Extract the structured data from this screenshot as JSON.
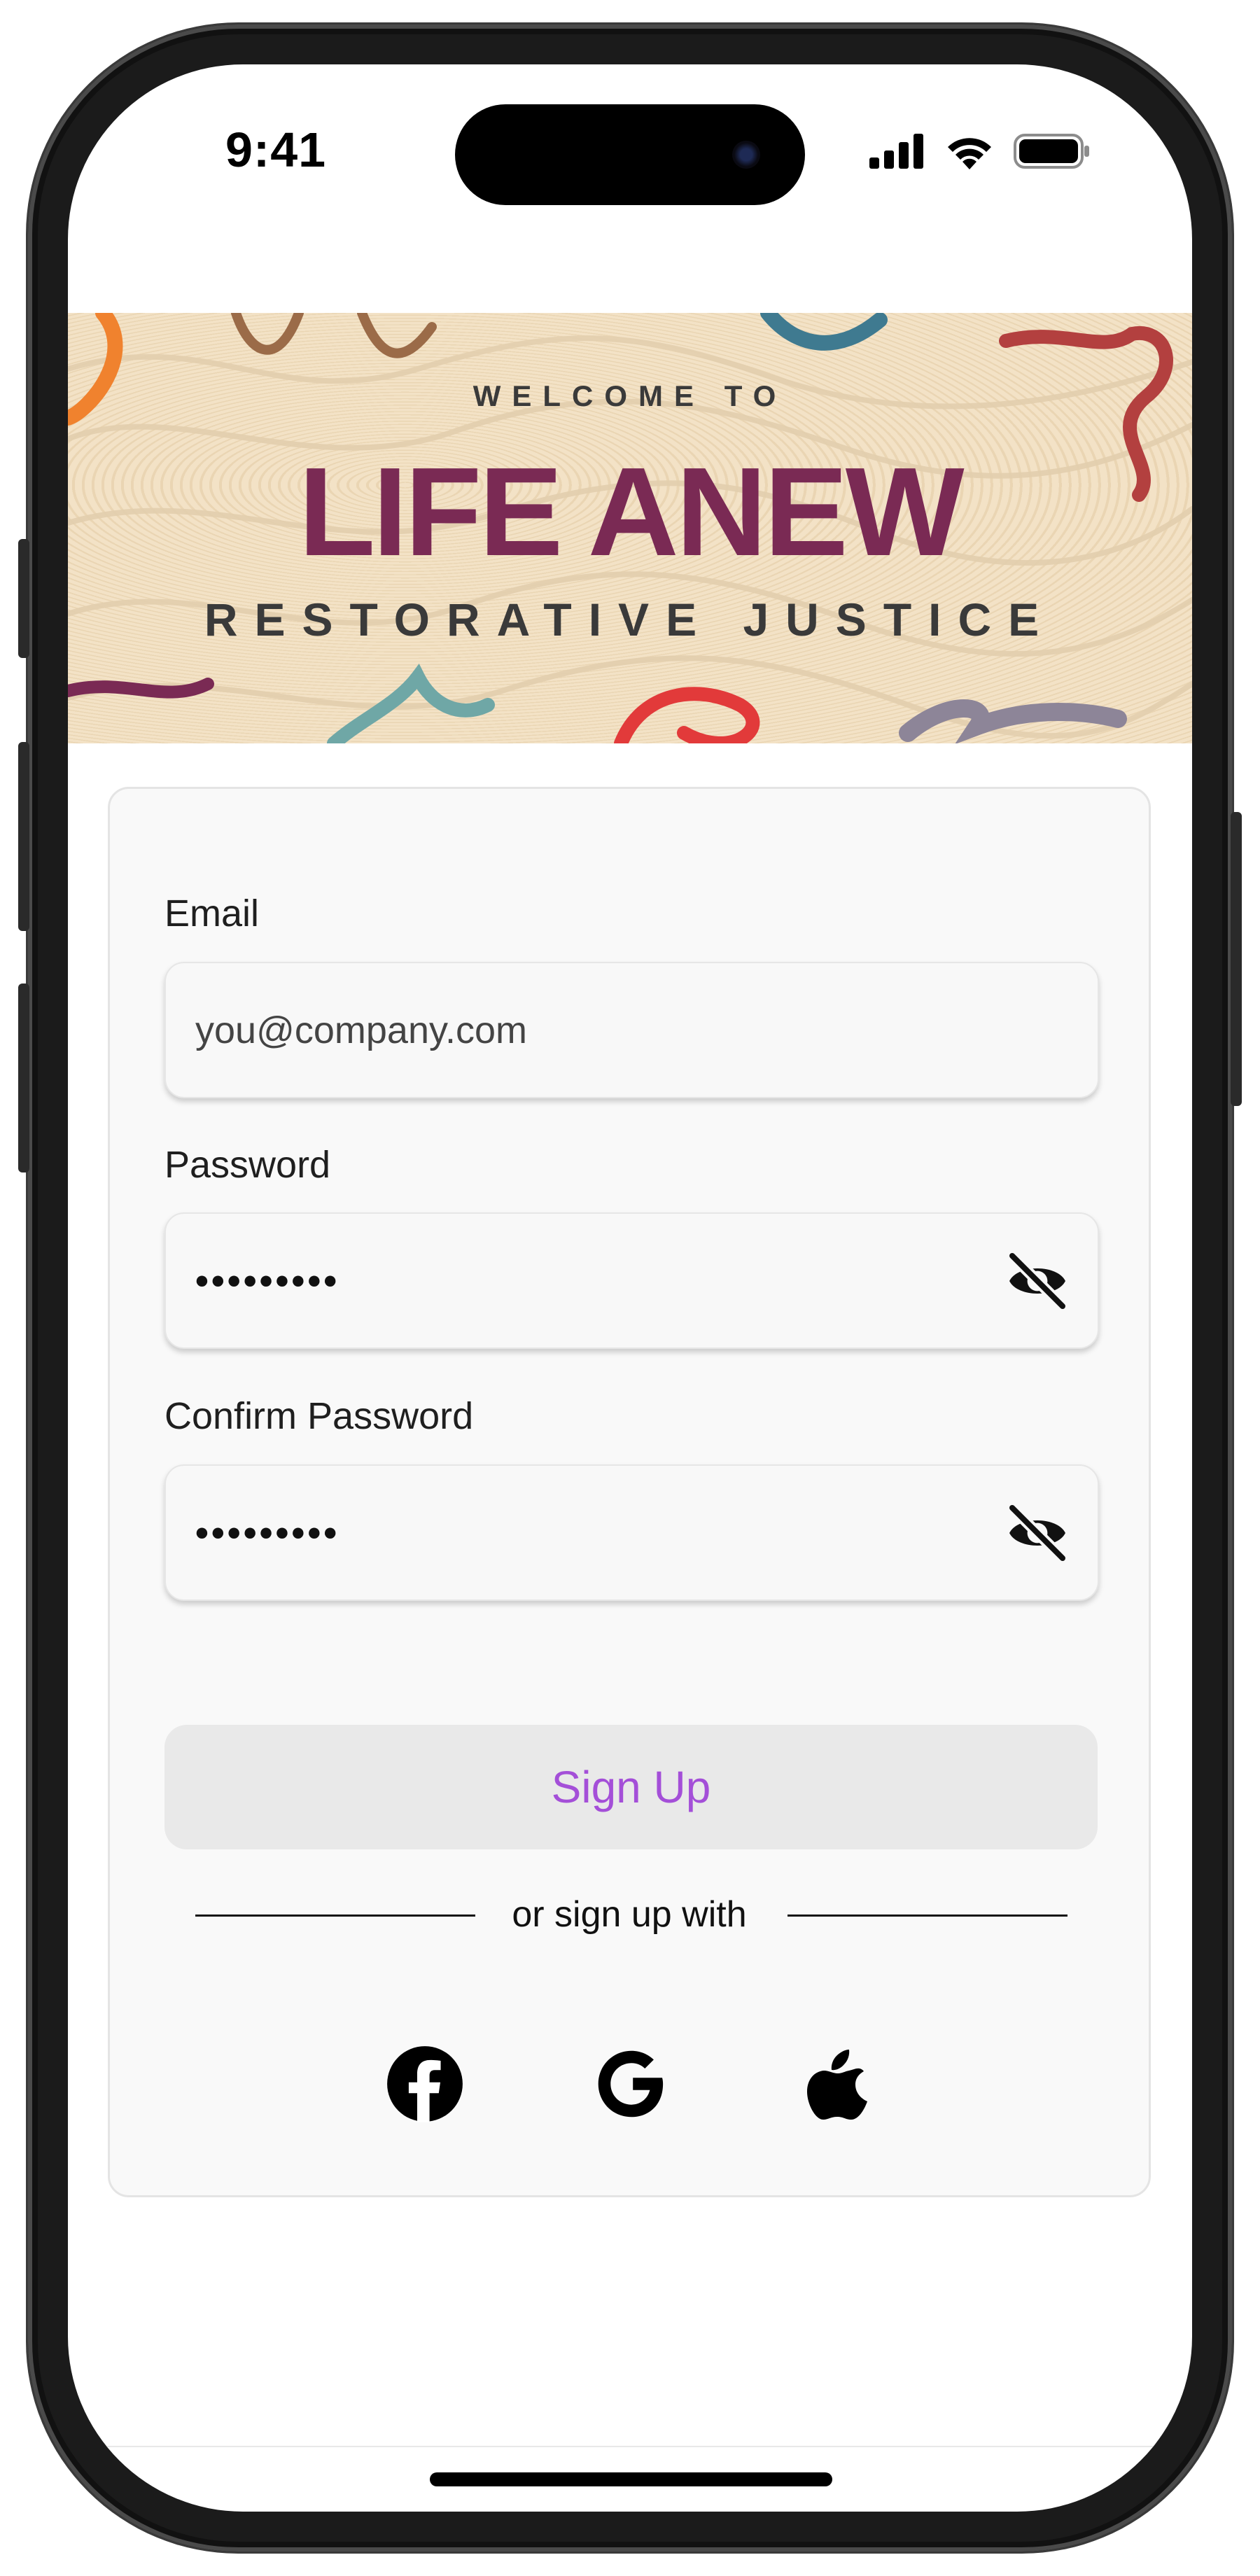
{
  "status_bar": {
    "time": "9:41"
  },
  "banner": {
    "welcome": "WELCOME TO",
    "brand": "LIFE ANEW",
    "tagline": "RESTORATIVE JUSTICE",
    "brand_color": "#7a2a54",
    "background_color": "#f3e2c6"
  },
  "form": {
    "email": {
      "label": "Email",
      "placeholder": "you@company.com"
    },
    "password": {
      "label": "Password",
      "value": "•••••••••",
      "toggle_icon": "eye-off-icon"
    },
    "confirm_password": {
      "label": "Confirm Password",
      "value": "•••••••••",
      "toggle_icon": "eye-off-icon"
    },
    "submit_label": "Sign Up",
    "submit_color": "#a44fd8",
    "divider_text": "or sign up with",
    "social": [
      "facebook-icon",
      "google-icon",
      "apple-icon"
    ]
  }
}
